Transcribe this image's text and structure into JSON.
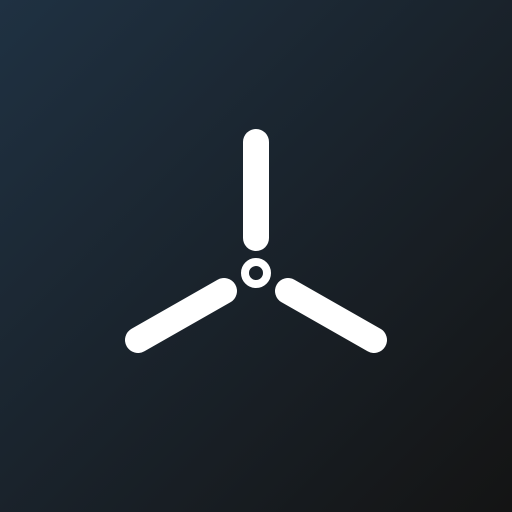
{
  "icon": {
    "symbol": "three-blade-propeller-icon",
    "blade_count": 3
  },
  "colors": {
    "background_top_left": "#1f3142",
    "background_bottom_right": "#141414",
    "glyph": "#ffffff"
  }
}
